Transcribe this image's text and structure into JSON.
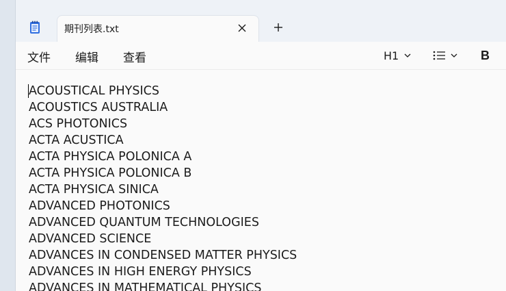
{
  "tab": {
    "title": "期刊列表.txt"
  },
  "menu": {
    "file": "文件",
    "edit": "编辑",
    "view": "查看"
  },
  "toolbar": {
    "heading": "H1",
    "bold": "B"
  },
  "icons": {
    "app": "notepad-icon",
    "close": "close-icon",
    "new_tab": "plus-icon",
    "list": "bulleted-list-icon",
    "chevron": "chevron-down-icon"
  },
  "colors": {
    "accent": "#2f6ee0",
    "text": "#1b1b1b",
    "chrome": "#eef2f7",
    "editor_bg": "#fafafa"
  },
  "document": {
    "lines": [
      "ACOUSTICAL PHYSICS",
      "ACOUSTICS AUSTRALIA",
      "ACS PHOTONICS",
      "ACTA ACUSTICA",
      "ACTA PHYSICA POLONICA A",
      "ACTA PHYSICA POLONICA B",
      "ACTA PHYSICA SINICA",
      "ADVANCED PHOTONICS",
      "ADVANCED QUANTUM TECHNOLOGIES",
      "ADVANCED SCIENCE",
      "ADVANCES IN CONDENSED MATTER PHYSICS",
      "ADVANCES IN HIGH ENERGY PHYSICS",
      "ADVANCES IN MATHEMATICAL PHYSICS"
    ]
  }
}
